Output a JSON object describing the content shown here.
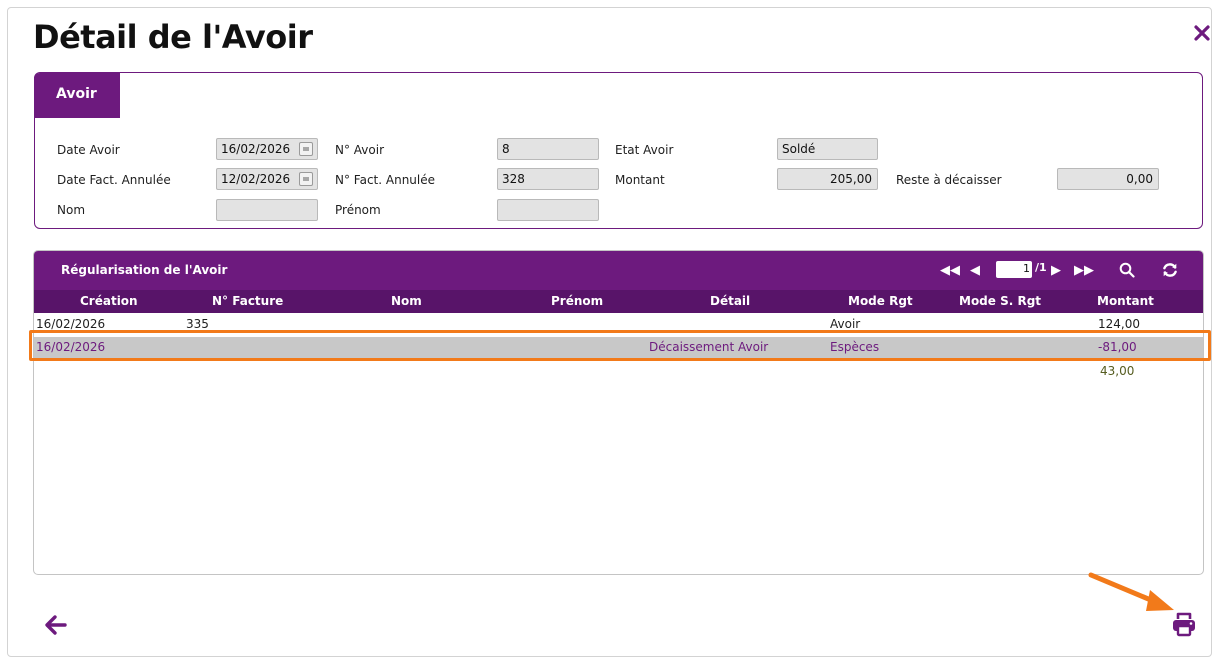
{
  "page": {
    "title": "Détail de l'Avoir"
  },
  "colors": {
    "purple": "#6d1a7e",
    "dark_purple": "#581469",
    "highlight": "#f27a1a",
    "total_text": "#555c20"
  },
  "icons": {
    "close": "close-icon",
    "back": "arrow-left-icon",
    "print": "printer-icon",
    "calendar": "calendar-icon"
  },
  "avoir": {
    "tab_label": "Avoir",
    "date_avoir": {
      "label": "Date Avoir",
      "value": "16/02/2026"
    },
    "date_fact_annulee": {
      "label": "Date Fact. Annulée",
      "value": "12/02/2026"
    },
    "nom": {
      "label": "Nom",
      "value": ""
    },
    "num_avoir": {
      "label": "N° Avoir",
      "value": "8"
    },
    "num_fact_annulee": {
      "label": "N° Fact. Annulée",
      "value": "328"
    },
    "prenom": {
      "label": "Prénom",
      "value": ""
    },
    "etat_avoir": {
      "label": "Etat Avoir",
      "value": "Soldé"
    },
    "montant": {
      "label": "Montant",
      "value": "205,00"
    },
    "reste": {
      "label": "Reste à décaisser",
      "value": "0,00"
    }
  },
  "regularisation": {
    "title": "Régularisation de l'Avoir",
    "pager": {
      "current_page": "1",
      "total_label": "/1"
    },
    "columns": {
      "creation": "Création",
      "num_facture": "N° Facture",
      "nom": "Nom",
      "prenom": "Prénom",
      "detail": "Détail",
      "mode_rgt": "Mode Rgt",
      "mode_s_rgt": "Mode S. Rgt",
      "montant": "Montant"
    },
    "rows": [
      {
        "creation": "16/02/2026",
        "num_facture": "335",
        "nom": "",
        "prenom": "",
        "detail": "",
        "mode_rgt": "Avoir",
        "mode_s_rgt": "",
        "montant": "124,00"
      },
      {
        "creation": "16/02/2026",
        "num_facture": "",
        "nom": "",
        "prenom": "",
        "detail": "Décaissement Avoir",
        "mode_rgt": "Espèces",
        "mode_s_rgt": "",
        "montant": "-81,00"
      }
    ],
    "total": "43,00"
  }
}
